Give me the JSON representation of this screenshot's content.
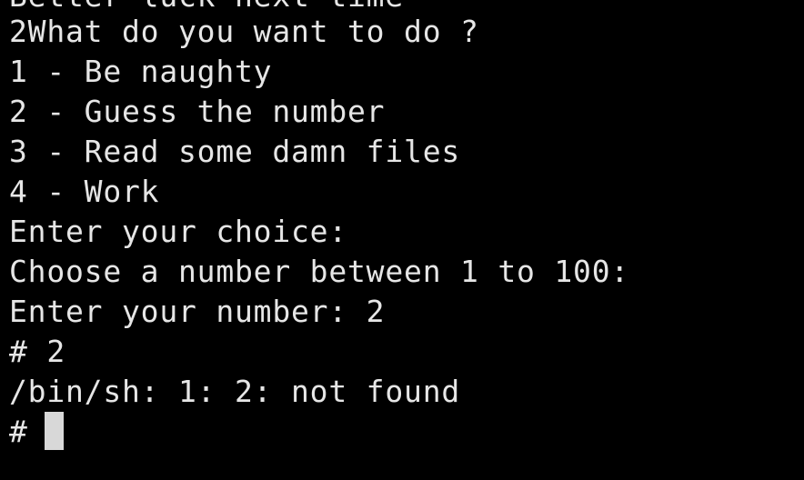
{
  "terminal": {
    "lines": [
      "Better luck next time",
      "2What do you want to do ?",
      "1 - Be naughty",
      "2 - Guess the number",
      "3 - Read some damn files",
      "4 - Work",
      "Enter your choice:",
      "Choose a number between 1 to 100:",
      "Enter your number: 2",
      "# 2",
      "/bin/sh: 1: 2: not found",
      "# "
    ],
    "colors": {
      "background": "#000000",
      "foreground": "#e6e6e6",
      "cursor": "#d8d8d8"
    }
  }
}
